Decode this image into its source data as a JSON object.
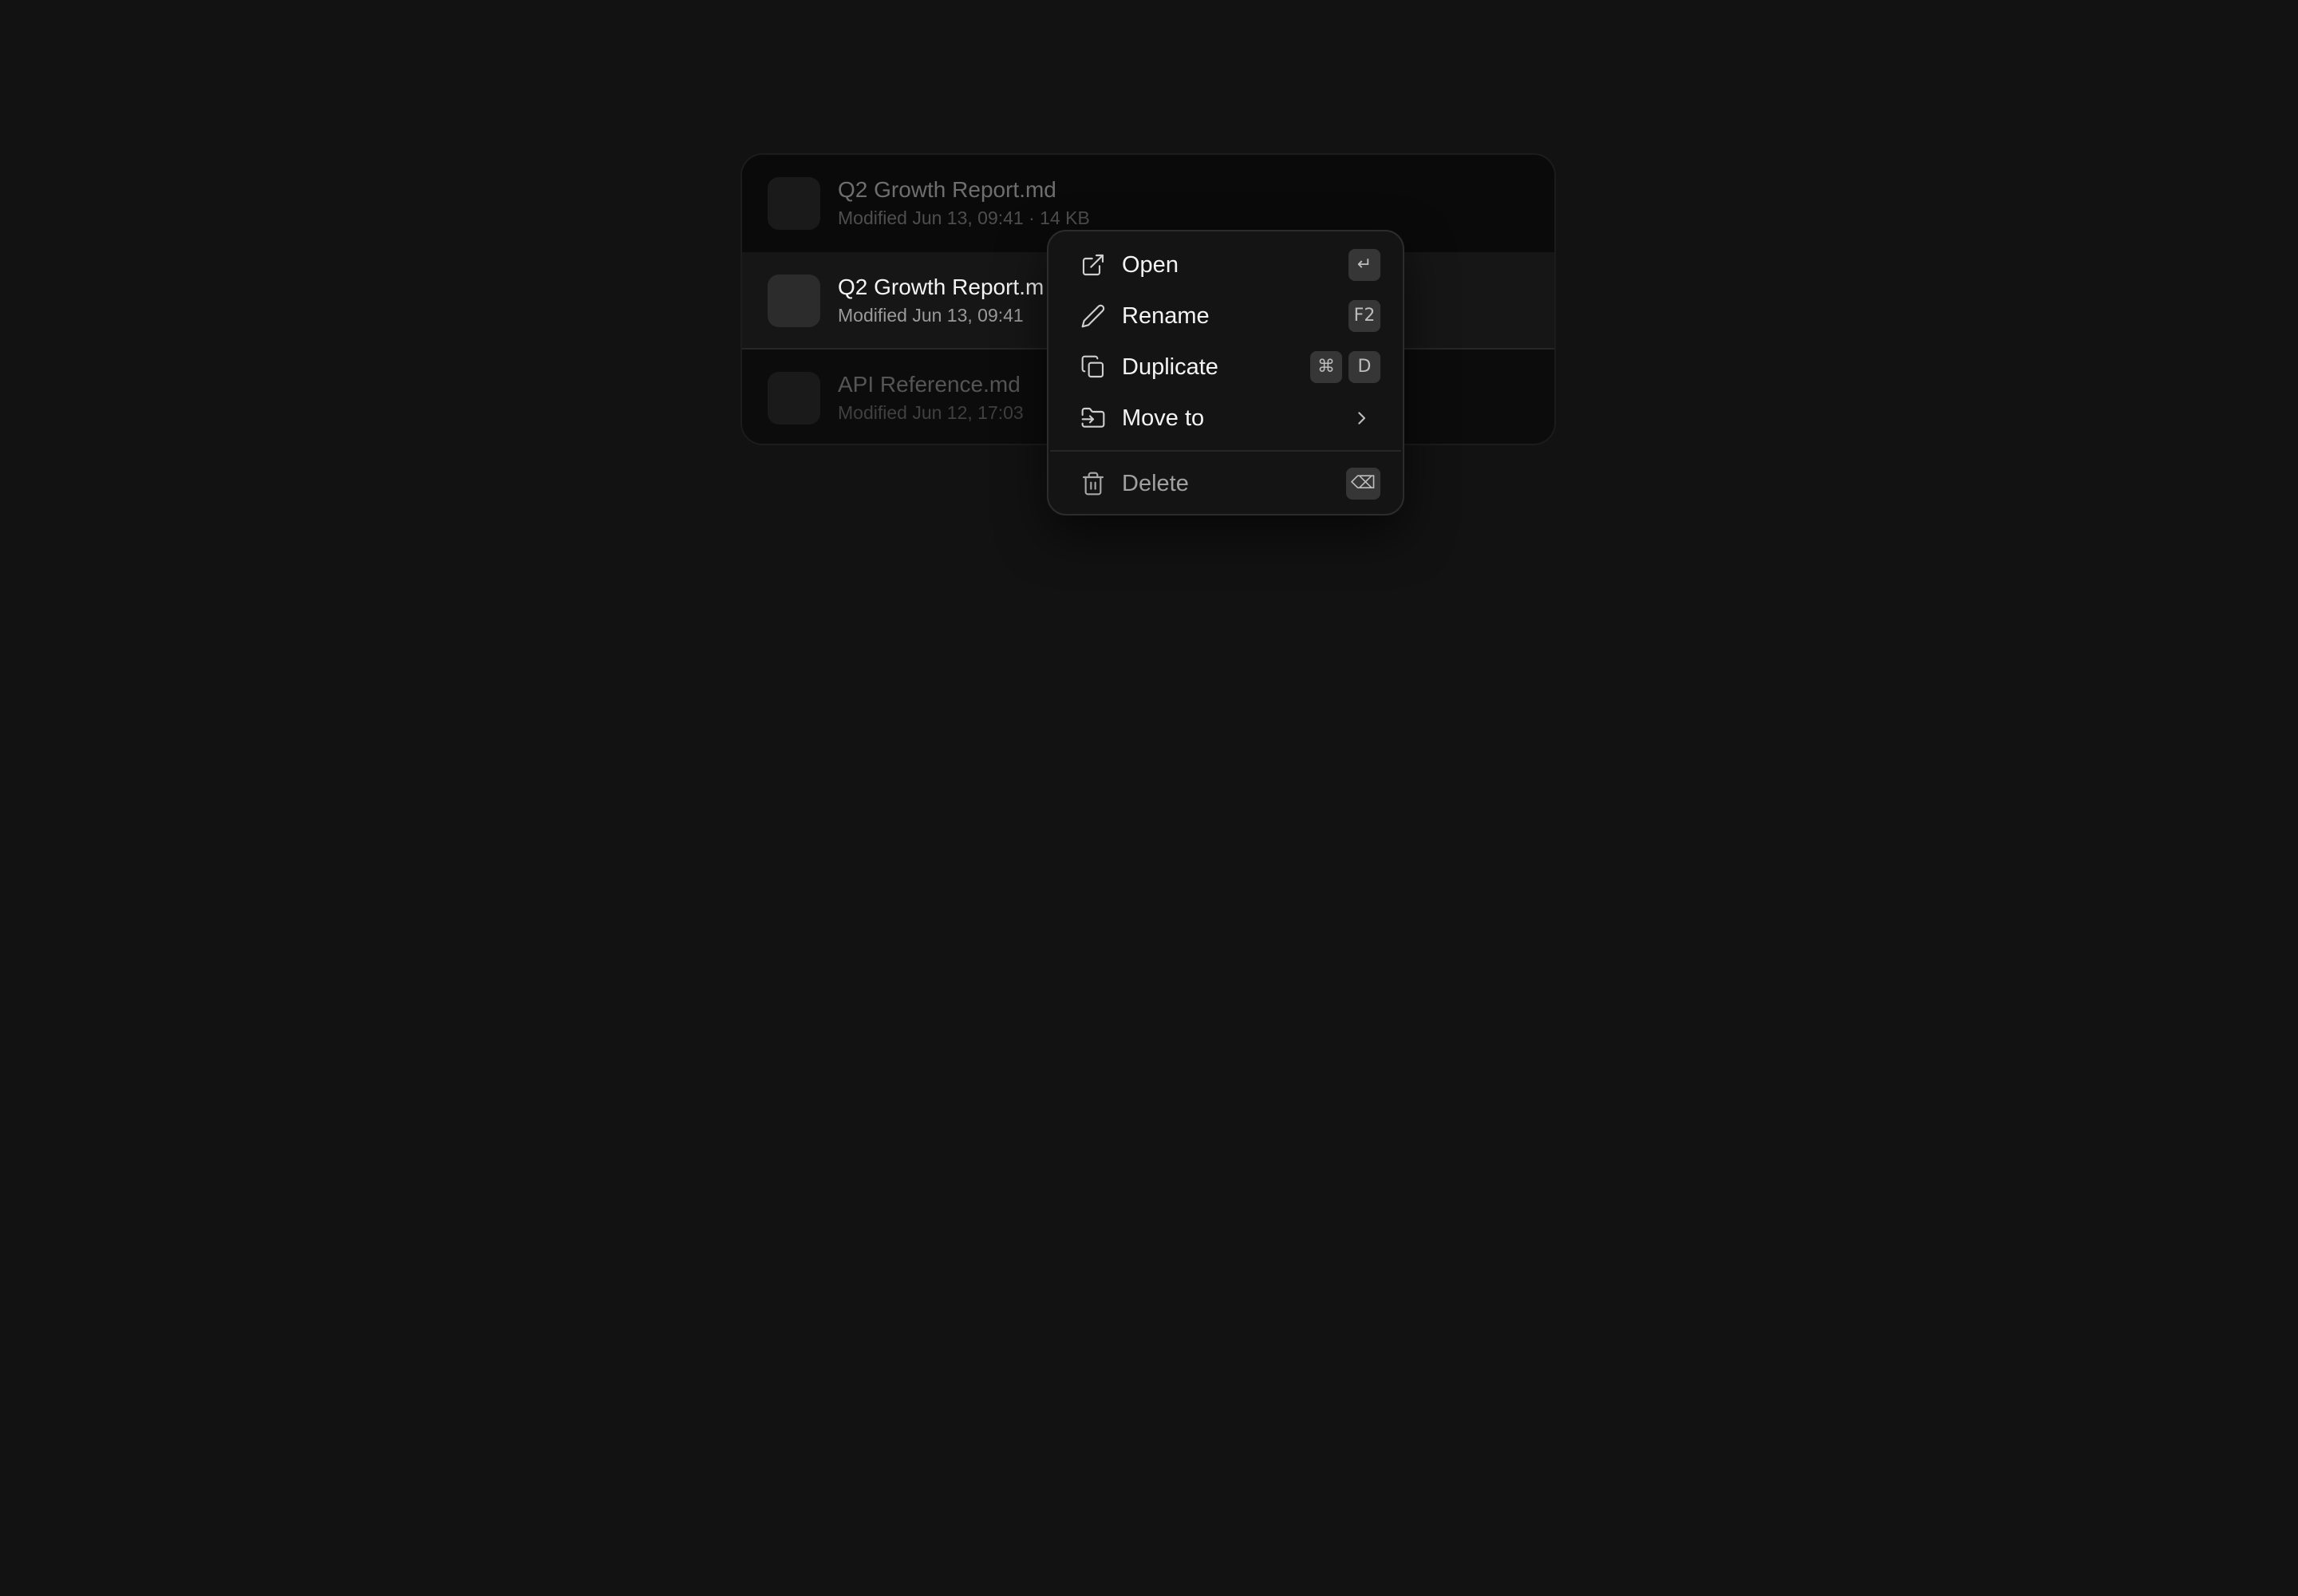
{
  "files": [
    {
      "name": "Q2 Growth Report.md",
      "meta": "Modified Jun 13, 09:41 · 14 KB",
      "state": "dimmed"
    },
    {
      "name": "Q2 Growth Report.m",
      "meta": "Modified Jun 13, 09:41",
      "state": "selected"
    },
    {
      "name": "API Reference.md",
      "meta": "Modified Jun 12, 17:03",
      "state": "dimmed"
    }
  ],
  "context_menu": {
    "open": {
      "label": "Open",
      "icon": "external-link-icon",
      "shortcut": "↵"
    },
    "rename": {
      "label": "Rename",
      "icon": "pencil-icon",
      "shortcut": "F2"
    },
    "duplicate": {
      "label": "Duplicate",
      "icon": "copy-icon",
      "shortcut_mod": "⌘",
      "shortcut_key": "D"
    },
    "move_to": {
      "label": "Move to",
      "icon": "folder-move-icon",
      "submenu_icon": "chevron-right-icon"
    },
    "delete": {
      "label": "Delete",
      "icon": "trash-icon",
      "shortcut": "⌫"
    }
  },
  "colors": {
    "background": "#121212",
    "menu_background": "#141414",
    "text_primary": "#f4f4f4",
    "text_muted": "#6e6e6e"
  }
}
